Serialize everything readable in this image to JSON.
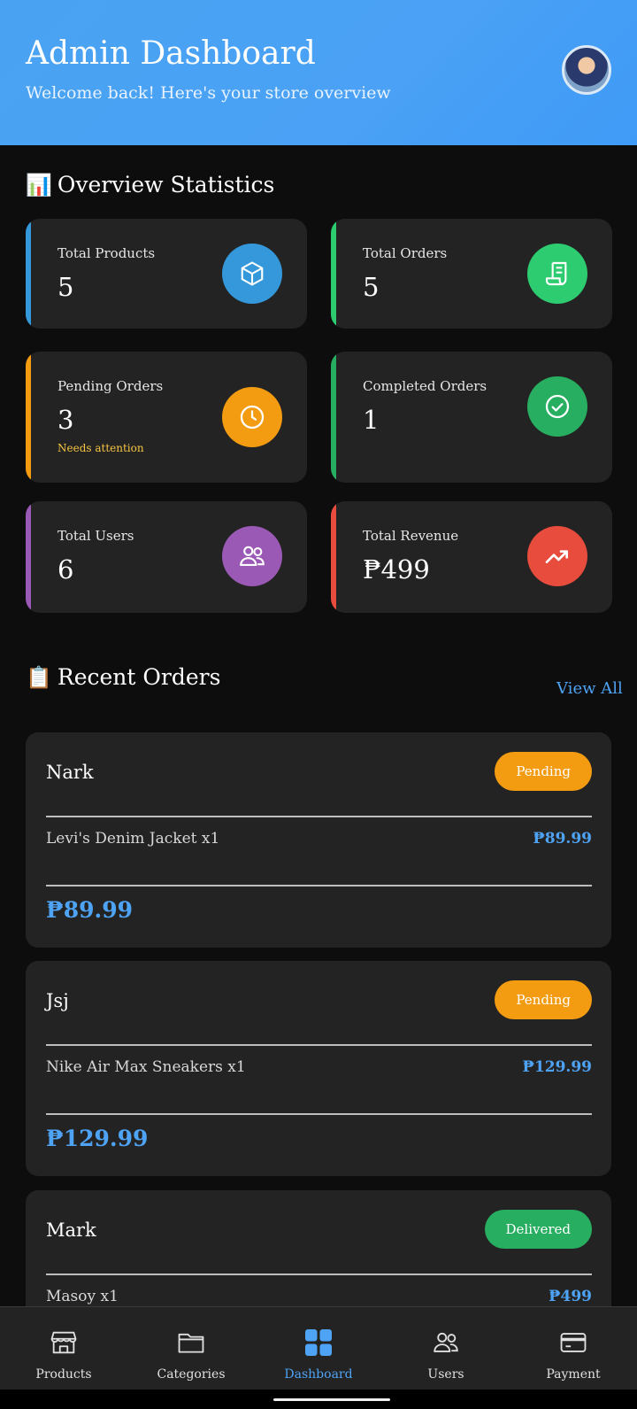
{
  "header": {
    "title": "Admin Dashboard",
    "subtitle": "Welcome back! Here's your store overview"
  },
  "overview": {
    "emoji": "📊",
    "title": "Overview Statistics",
    "cards": [
      {
        "label": "Total Products",
        "value": "5",
        "note": "",
        "color": "#3498db",
        "icon": "box-icon"
      },
      {
        "label": "Total Orders",
        "value": "5",
        "note": "",
        "color": "#2ecc71",
        "icon": "receipt-icon"
      },
      {
        "label": "Pending Orders",
        "value": "3",
        "note": "Needs attention",
        "color": "#f39c12",
        "icon": "clock-icon"
      },
      {
        "label": "Completed Orders",
        "value": "1",
        "note": "",
        "color": "#27ae60",
        "icon": "check-circle-icon"
      },
      {
        "label": "Total Users",
        "value": "6",
        "note": "",
        "color": "#9b59b6",
        "icon": "users-icon"
      },
      {
        "label": "Total Revenue",
        "value": "₱499",
        "note": "",
        "color": "#e74c3c",
        "icon": "trending-up-icon"
      }
    ]
  },
  "recent": {
    "emoji": "📋",
    "title": "Recent Orders",
    "view_all": "View All",
    "orders": [
      {
        "name": "Nark",
        "status": "Pending",
        "status_color": "#f39c12",
        "item": "Levi's Denim  Jacket x1",
        "item_price": "₱89.99",
        "total": "₱89.99"
      },
      {
        "name": "Jsj",
        "status": "Pending",
        "status_color": "#f39c12",
        "item": "Nike Air Max Sneakers x1",
        "item_price": "₱129.99",
        "total": "₱129.99"
      },
      {
        "name": "Mark",
        "status": "Delivered",
        "status_color": "#27ae60",
        "item": "Masoy x1",
        "item_price": "₱499",
        "total": ""
      }
    ]
  },
  "nav": {
    "items": [
      {
        "label": "Products",
        "icon": "store-icon"
      },
      {
        "label": "Categories",
        "icon": "folder-icon"
      },
      {
        "label": "Dashboard",
        "icon": "grid-icon"
      },
      {
        "label": "Users",
        "icon": "users-icon"
      },
      {
        "label": "Payment",
        "icon": "card-icon"
      }
    ],
    "active": "Dashboard",
    "accent": "#4ea3f5"
  }
}
